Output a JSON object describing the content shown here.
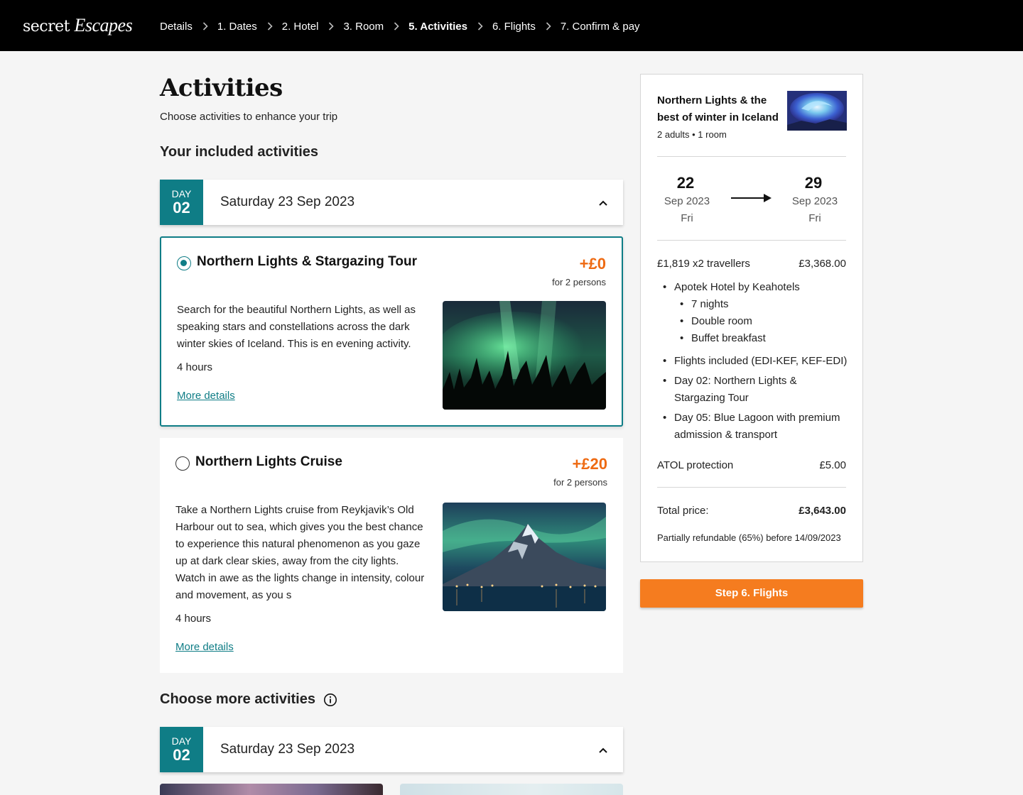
{
  "header": {
    "logo_word": "secret",
    "logo_script": "Escapes",
    "steps": [
      "Details",
      "1. Dates",
      "2. Hotel",
      "3. Room",
      "5. Activities",
      "6. Flights",
      "7. Confirm & pay"
    ],
    "active_step": "5. Activities",
    "chevron_icon": "chevron-right-icon"
  },
  "page": {
    "title": "Activities",
    "subtitle": "Choose activities to enhance your trip",
    "included_heading": "Your included activities",
    "more_heading": "Choose more activities",
    "info_icon": "info-icon"
  },
  "included_day": {
    "badge_label": "DAY",
    "badge_num": "02",
    "date": "Saturday 23 Sep 2023",
    "toggle_icon": "chevron-up-icon"
  },
  "activities": [
    {
      "title": "Northern Lights & Stargazing Tour",
      "price": "+£0",
      "per": "for 2 persons",
      "description": "Search for the beautiful Northern Lights, as well as speaking stars and constellations across the dark winter skies of Iceland. This is en evening activity.",
      "duration": "4 hours",
      "link": "More details",
      "selected": true,
      "image_icon": "aurora-forest-image"
    },
    {
      "title": "Northern Lights Cruise",
      "price": "+£20",
      "per": "for 2 persons",
      "description": "Take a Northern Lights cruise from Reykjavik’s Old Harbour out to sea, which gives you the best chance to experience this natural phenomenon as you gaze up at dark clear skies, away from the city lights. Watch in awe as the lights change in intensity, colour and movement, as you s",
      "duration": "4 hours",
      "link": "More details",
      "selected": false,
      "image_icon": "aurora-mountain-harbour-image"
    }
  ],
  "more_day": {
    "badge_label": "DAY",
    "badge_num": "02",
    "date": "Saturday 23 Sep 2023",
    "toggle_icon": "chevron-up-icon"
  },
  "summary": {
    "title": "Northern Lights & the best of winter in Iceland",
    "guests": "2 adults • 1 room",
    "checkin": {
      "day": "22",
      "month": "Sep 2023",
      "weekday": "Fri"
    },
    "checkout": {
      "day": "29",
      "month": "Sep 2023",
      "weekday": "Fri"
    },
    "travellers_label": "£1,819 x2 travellers",
    "travellers_value": "£3,368.00",
    "hotel": "Apotek Hotel by Keahotels",
    "hotel_details": [
      "7 nights",
      "Double room",
      "Buffet breakfast"
    ],
    "flights": "Flights included (EDI-KEF, KEF-EDI)",
    "activity_lines": [
      "Day 02: Northern Lights & Stargazing Tour",
      "Day 05: Blue Lagoon with premium admission & transport"
    ],
    "atol_label": "ATOL protection",
    "atol_value": "£5.00",
    "total_label": "Total price:",
    "total_value": "£3,643.00",
    "refund": "Partially refundable (65%) before 14/09/2023"
  },
  "cta": {
    "label": "Step 6. Flights"
  },
  "colors": {
    "teal": "#0f7d86",
    "orange": "#f57c1f",
    "price_orange": "#ee6a12",
    "header_bg": "#000000"
  }
}
